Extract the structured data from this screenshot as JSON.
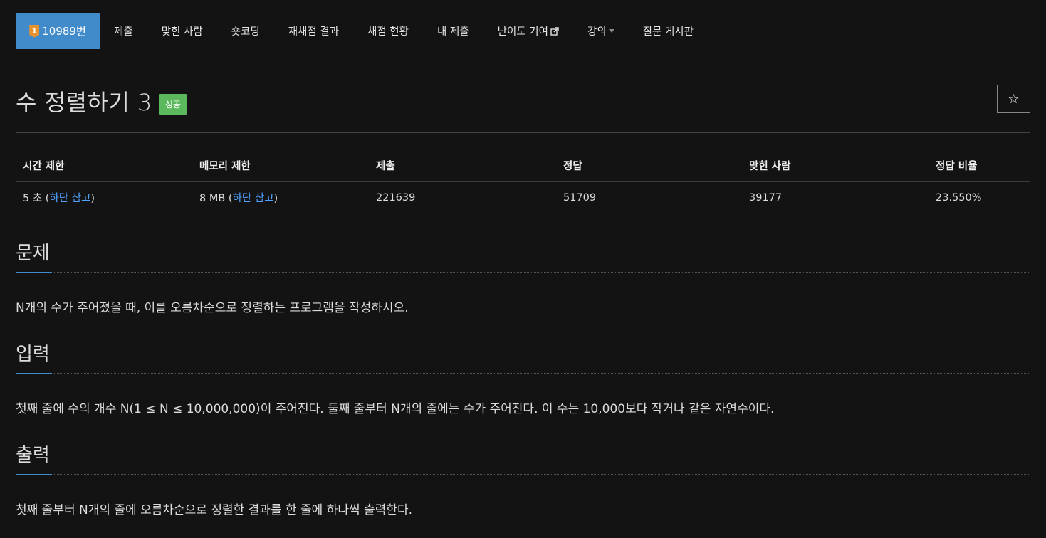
{
  "nav": {
    "active_label": "10989번",
    "tier_digit": "1",
    "items": [
      "제출",
      "맞힌 사람",
      "숏코딩",
      "재채점 결과",
      "채점 현황",
      "내 제출",
      "난이도 기여",
      "강의",
      "질문 게시판"
    ]
  },
  "title": {
    "text": "수 정렬하기 3",
    "badge": "성공",
    "star": "☆"
  },
  "info": {
    "headers": [
      "시간 제한",
      "메모리 제한",
      "제출",
      "정답",
      "맞힌 사람",
      "정답 비율"
    ],
    "time_limit_prefix": "5 초 (",
    "time_limit_link": "하단 참고",
    "time_limit_suffix": ")",
    "memory_limit_prefix": "8 MB (",
    "memory_limit_link": "하단 참고",
    "memory_limit_suffix": ")",
    "submissions": "221639",
    "accepted": "51709",
    "solved_users": "39177",
    "ratio": "23.550%"
  },
  "sections": {
    "problem_title": "문제",
    "problem_text": "N개의 수가 주어졌을 때, 이를 오름차순으로 정렬하는 프로그램을 작성하시오.",
    "input_title": "입력",
    "input_text": "첫째 줄에 수의 개수 N(1 ≤ N ≤ 10,000,000)이 주어진다. 둘째 줄부터 N개의 줄에는 수가 주어진다. 이 수는 10,000보다 작거나 같은 자연수이다.",
    "output_title": "출력",
    "output_text": "첫째 줄부터 N개의 줄에 오름차순으로 정렬한 결과를 한 줄에 하나씩 출력한다."
  },
  "colors": {
    "accent": "#428bca",
    "success": "#5cb85c",
    "link": "#4fa3ff",
    "background": "#131313"
  }
}
